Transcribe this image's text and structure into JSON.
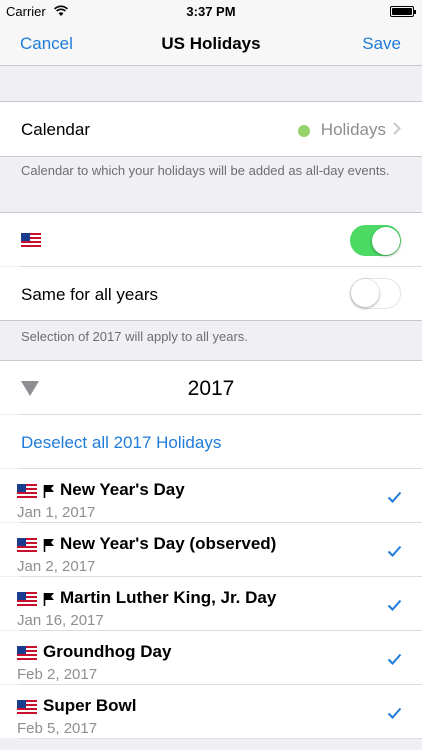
{
  "status_bar": {
    "carrier": "Carrier",
    "time": "3:37 PM"
  },
  "nav": {
    "cancel": "Cancel",
    "title": "US Holidays",
    "save": "Save"
  },
  "calendar": {
    "label": "Calendar",
    "value": "Holidays",
    "dot_color": "#95d26a",
    "footer": "Calendar to which your holidays will be added as all-day events."
  },
  "country_toggle": {
    "flag": "us-flag-icon",
    "enabled": true
  },
  "same_years": {
    "label": "Same for all years",
    "enabled": false
  },
  "selection_note": "Selection of 2017 will apply to all years.",
  "year_section": {
    "year": "2017",
    "deselect_label": "Deselect all 2017 Holidays"
  },
  "holidays": [
    {
      "name": "New Year's Day",
      "date": "Jan 1, 2017",
      "flagged": true,
      "checked": true
    },
    {
      "name": "New Year's Day (observed)",
      "date": "Jan 2, 2017",
      "flagged": true,
      "checked": true
    },
    {
      "name": "Martin Luther King, Jr. Day",
      "date": "Jan 16, 2017",
      "flagged": true,
      "checked": true
    },
    {
      "name": "Groundhog Day",
      "date": "Feb 2, 2017",
      "flagged": false,
      "checked": true
    },
    {
      "name": "Super Bowl",
      "date": "Feb 5, 2017",
      "flagged": false,
      "checked": true
    }
  ],
  "colors": {
    "accent": "#1e7bd9",
    "switch_on": "#4cd964",
    "background": "#efeff4"
  }
}
